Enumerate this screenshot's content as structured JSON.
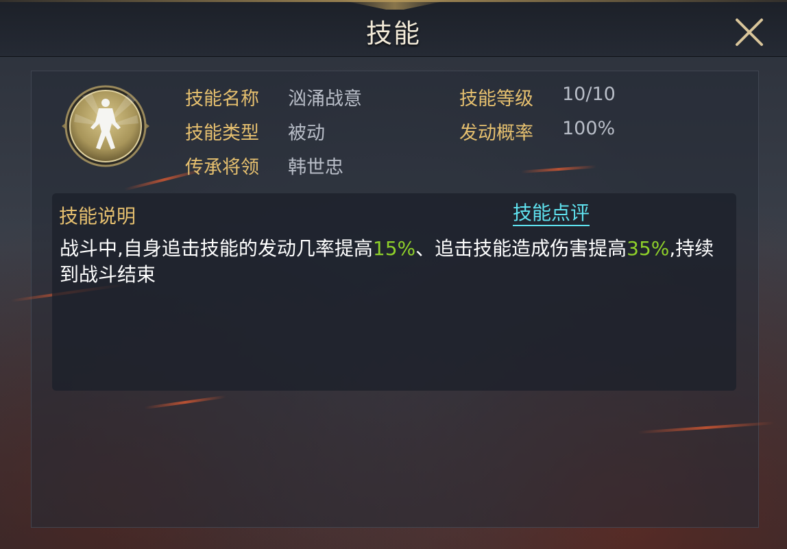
{
  "window": {
    "title": "技能"
  },
  "icons": {
    "close": "close-icon",
    "skill": "warrior-stance-icon"
  },
  "colors": {
    "label": "#e6c06f",
    "value": "#b9bec8",
    "highlight": "#8fd12a",
    "link": "#5fe3f0"
  },
  "skill_info": {
    "name_label": "技能名称",
    "name_value": "汹涌战意",
    "level_label": "技能等级",
    "level_value": "10/10",
    "type_label": "技能类型",
    "type_value": "被动",
    "rate_label": "发动概率",
    "rate_value": "100%",
    "general_label": "传承将领",
    "general_value": "韩世忠"
  },
  "description": {
    "title": "技能说明",
    "review_link": "技能点评",
    "seg1": "战斗中,自身追击技能的发动几率提高",
    "val1": "15%",
    "seg2": "、追击技能造成伤害提高",
    "val2": "35%",
    "seg3": ",持续到战斗结束"
  }
}
